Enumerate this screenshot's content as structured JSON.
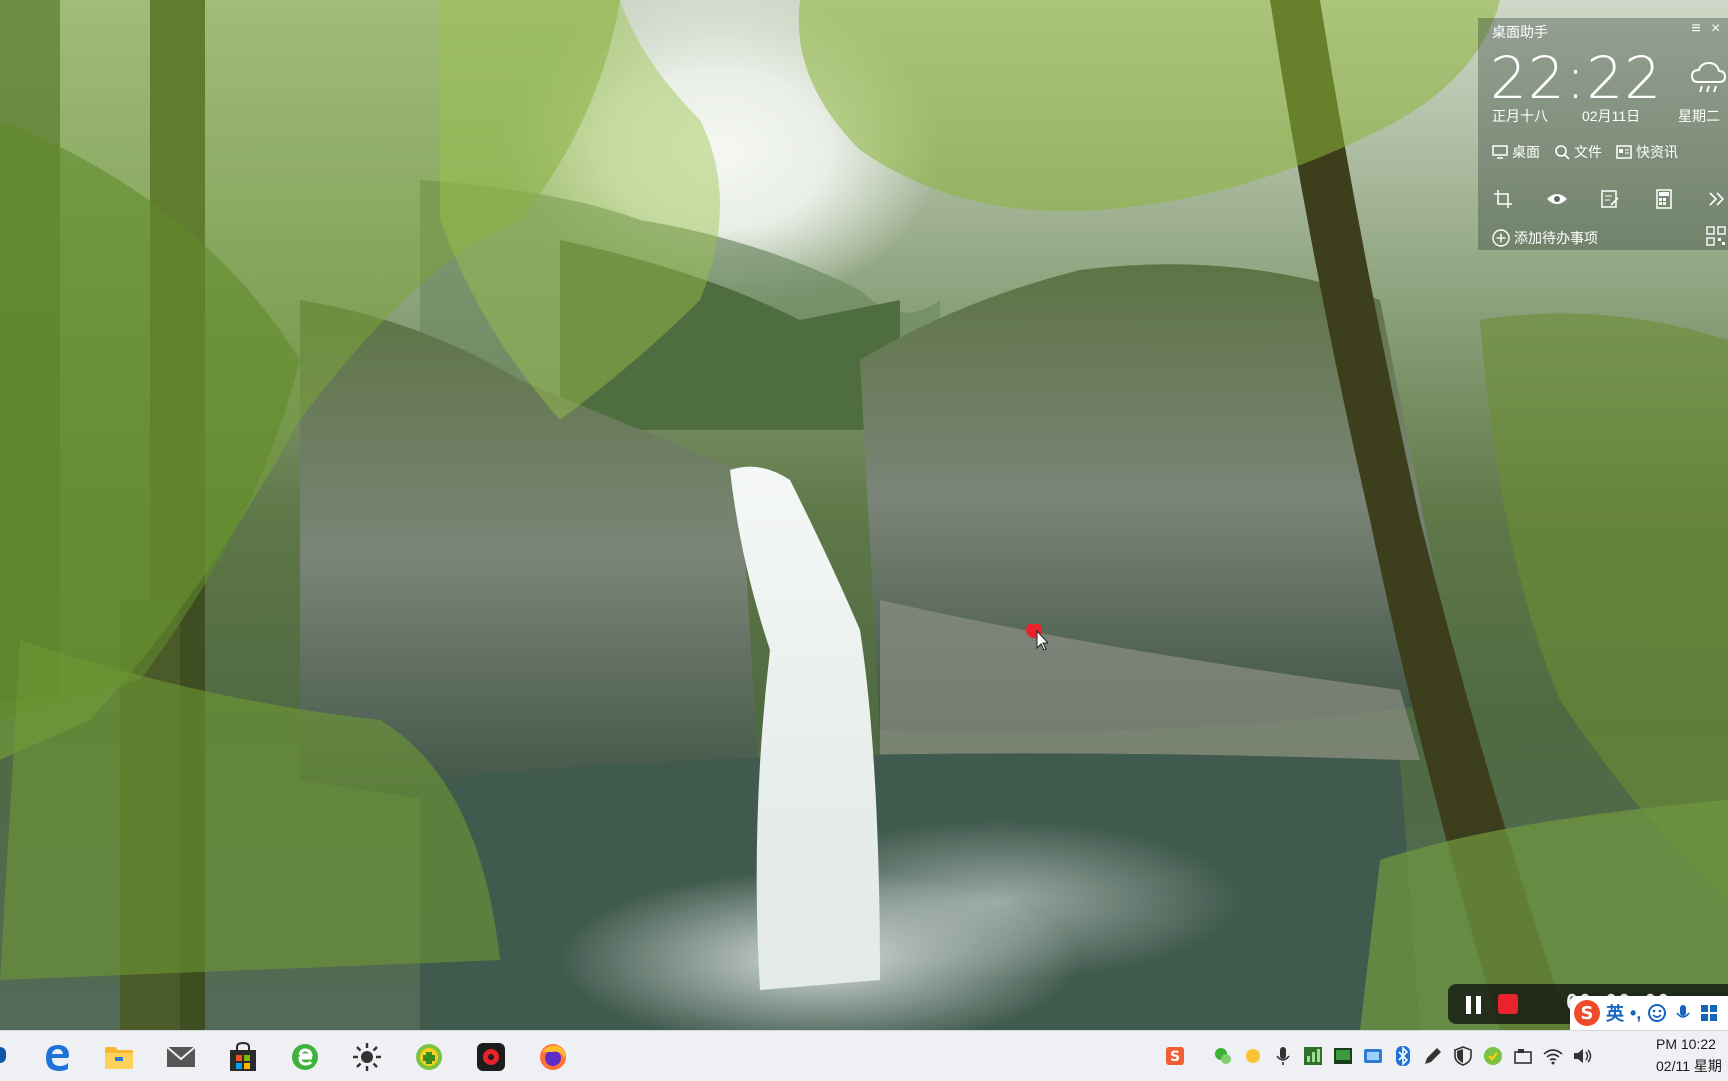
{
  "widget": {
    "title": "桌面助手",
    "time": "22:22",
    "lunar_date": "正月十八",
    "date": "02月11日",
    "weekday": "星期二",
    "links": [
      "桌面",
      "文件",
      "快资讯"
    ],
    "todo_label": "添加待办事项",
    "icons": {
      "menu": "menu-icon",
      "weather": "cloud-rain-icon",
      "crop": "crop-icon",
      "eye": "eye-icon",
      "notes": "notes-icon",
      "calculator": "calculator-icon",
      "more": "double-chevron-right-icon",
      "qr": "qr-code-icon"
    }
  },
  "recorder": {
    "time": "00:00:00",
    "pause_icon": "pause-icon",
    "stop_icon": "stop-icon"
  },
  "ime": {
    "logo": "S",
    "language": "英",
    "punctuation": "•,"
  },
  "taskbar": {
    "apps": [
      "edge-icon",
      "file-explorer-icon",
      "mail-icon",
      "store-icon",
      "browser-e-icon",
      "brightness-icon",
      "game-center-icon",
      "screen-recorder-icon",
      "firefox-icon"
    ],
    "tray": [
      "sogou-icon",
      "wechat-icon",
      "weather-sun-icon",
      "microphone-icon",
      "chart-icon",
      "monitor-icon",
      "network-adapter-icon",
      "bluetooth-icon",
      "pen-icon",
      "shield-icon",
      "security-icon",
      "usb-icon",
      "wifi-icon",
      "volume-icon"
    ],
    "clock_time": "PM 10:22",
    "clock_date": "02/11 星期"
  },
  "colors": {
    "accent_red": "#e8232a",
    "ime_blue": "#1565c0",
    "taskbar_bg": "#eef0f3"
  }
}
